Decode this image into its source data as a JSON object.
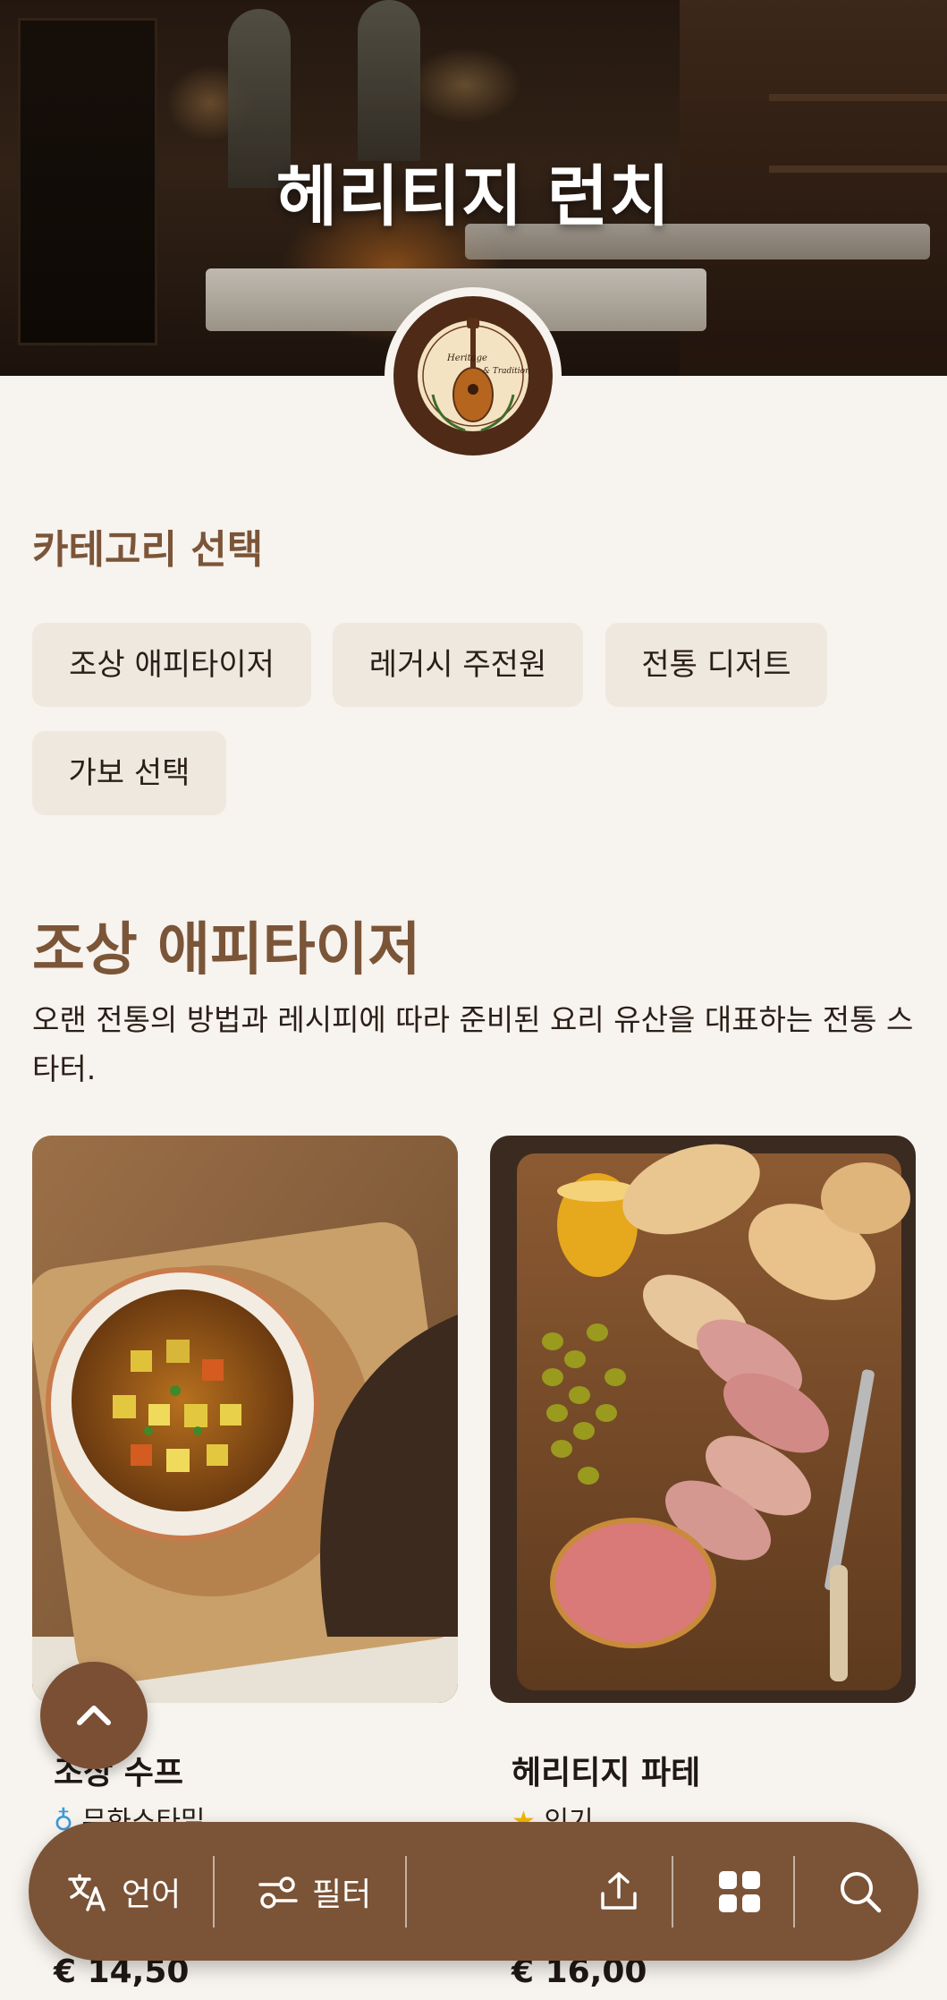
{
  "hero": {
    "title": "헤리티지 런치",
    "logo_icon": "mandolin-logo-icon",
    "logo_text_top": "Heritage",
    "logo_text_mid": "& Tradition"
  },
  "categories": {
    "label": "카테고리 선택",
    "items": [
      {
        "label": "조상 애피타이저"
      },
      {
        "label": "레거시 주전원"
      },
      {
        "label": "전통 디저트"
      },
      {
        "label": "가보 선택"
      }
    ]
  },
  "section": {
    "title": "조상 애피타이저",
    "description": "오랜 전통의 방법과 레시피에 따라 준비된 요리 유산을 대표하는 전통 스타터."
  },
  "products": [
    {
      "name": "조상 수프",
      "badge": "무화스타밀",
      "badge_icon": "fork-sparkle-icon",
      "price": "€ 14,50"
    },
    {
      "name": "헤리티지 파테",
      "badge": "인기",
      "badge_icon": "star-icon",
      "price": "€ 16,00"
    }
  ],
  "bottom_bar": {
    "language_label": "언어",
    "filter_label": "필터",
    "icons": [
      "translate-icon",
      "filter-icon",
      "share-icon",
      "grid-icon",
      "search-icon"
    ]
  },
  "colors": {
    "accent": "#7b5538",
    "bar": "#7b5336",
    "background": "#f7f3ee",
    "chip": "#efe8df"
  }
}
